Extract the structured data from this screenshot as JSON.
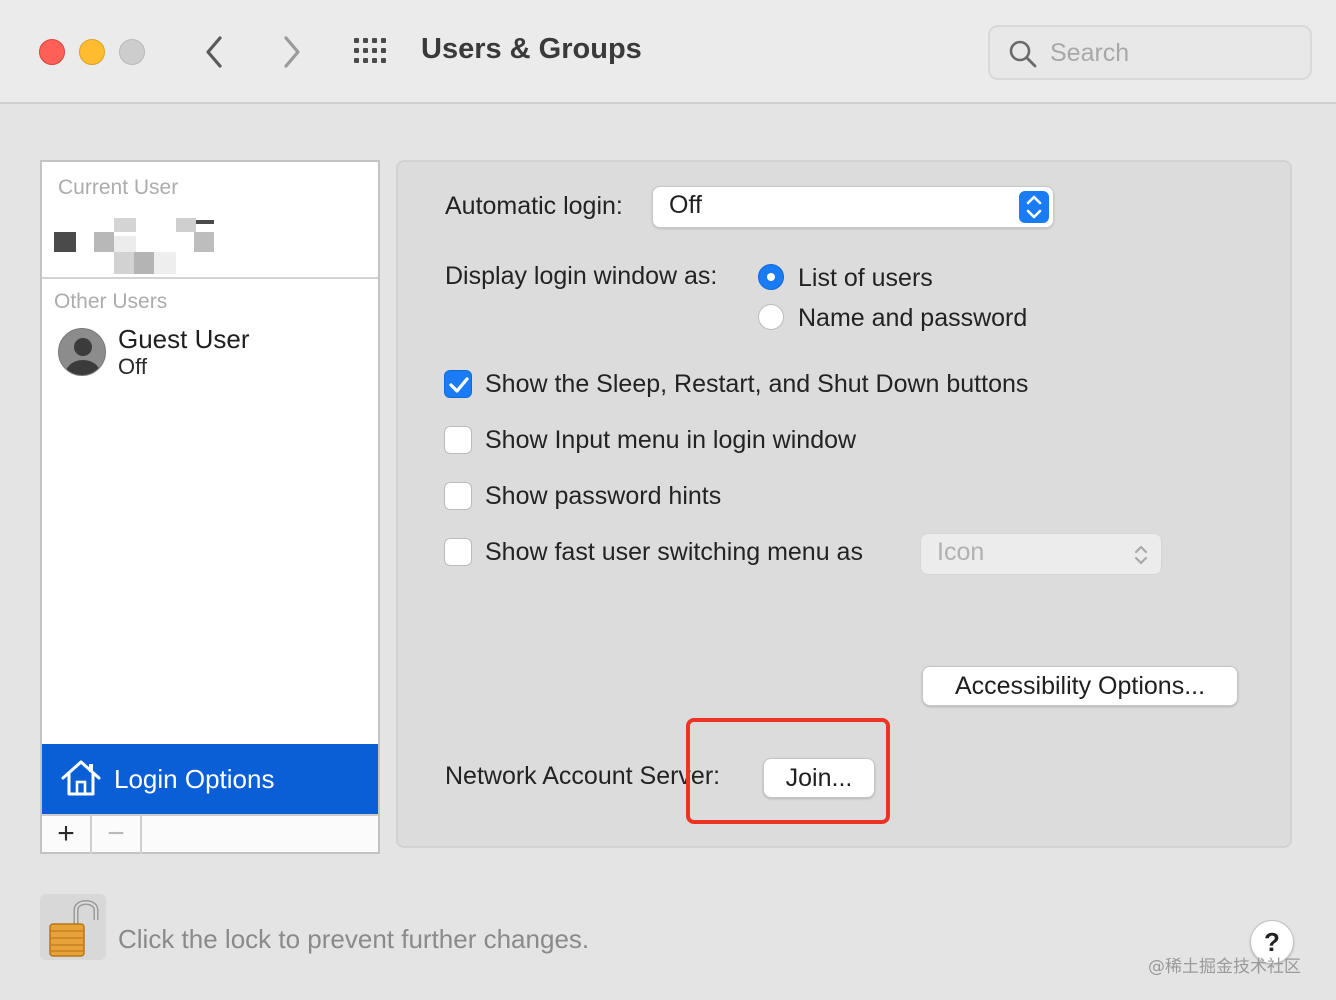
{
  "window": {
    "title": "Users & Groups",
    "search_placeholder": "Search"
  },
  "sidebar": {
    "current_user_heading": "Current User",
    "other_users_heading": "Other Users",
    "guest": {
      "name": "Guest User",
      "status": "Off"
    },
    "login_options_label": "Login Options",
    "add_label": "+",
    "remove_label": "−"
  },
  "main": {
    "automatic_login": {
      "label": "Automatic login:",
      "value": "Off"
    },
    "display_login": {
      "label": "Display login window as:",
      "options": [
        {
          "label": "List of users",
          "selected": true
        },
        {
          "label": "Name and password",
          "selected": false
        }
      ]
    },
    "checkboxes": [
      {
        "label": "Show the Sleep, Restart, and Shut Down buttons",
        "checked": true
      },
      {
        "label": "Show Input menu in login window",
        "checked": false
      },
      {
        "label": "Show password hints",
        "checked": false
      },
      {
        "label": "Show fast user switching menu as",
        "checked": false
      }
    ],
    "fast_switch_value": "Icon",
    "accessibility_button": "Accessibility Options...",
    "network_label": "Network Account Server:",
    "join_button": "Join..."
  },
  "footer": {
    "lock_text": "Click the lock to prevent further changes.",
    "help_label": "?",
    "watermark": "@稀土掘金技术社区"
  },
  "colors": {
    "accent": "#1a7cf5",
    "selection": "#0a5fd6",
    "highlight_box": "#ec3324"
  }
}
